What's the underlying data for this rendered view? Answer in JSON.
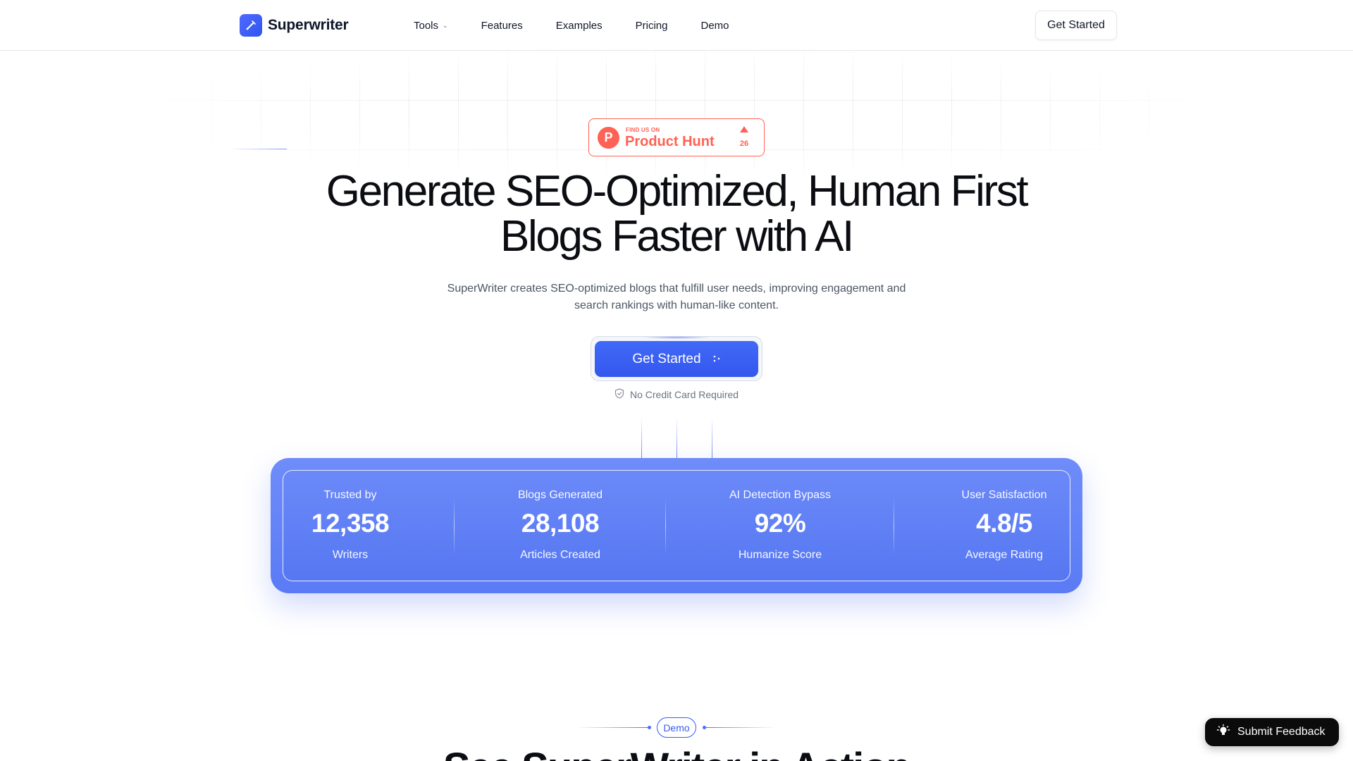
{
  "brand": {
    "name": "Superwriter",
    "logo_icon": "pen-icon",
    "accent": "#3b5bf0"
  },
  "nav": {
    "items": [
      {
        "label": "Tools",
        "has_dropdown": true
      },
      {
        "label": "Features"
      },
      {
        "label": "Examples"
      },
      {
        "label": "Pricing"
      },
      {
        "label": "Demo"
      }
    ],
    "cta_label": "Get Started"
  },
  "product_hunt": {
    "small_text": "FIND US ON",
    "big_text": "Product Hunt",
    "letter": "P",
    "upvotes": "26",
    "color": "#ff6154"
  },
  "hero": {
    "title_line1": "Generate SEO-Optimized, Human First",
    "title_line2": "Blogs Faster with AI",
    "subtitle_line1": "SuperWriter creates SEO-optimized blogs that fulfill user needs, improving engagement and",
    "subtitle_line2": "search rankings with human-like content.",
    "cta_label": "Get Started",
    "cta_icon": "sparkle-dots-icon",
    "note": "No Credit Card Required",
    "note_icon": "shield-check-icon"
  },
  "stats": [
    {
      "label": "Trusted by",
      "value": "12,358",
      "sub": "Writers"
    },
    {
      "label": "Blogs Generated",
      "value": "28,108",
      "sub": "Articles Created"
    },
    {
      "label": "AI Detection Bypass",
      "value": "92%",
      "sub": "Humanize Score"
    },
    {
      "label": "User Satisfaction",
      "value": "4.8/5",
      "sub": "Average Rating"
    }
  ],
  "demo": {
    "pill": "Demo",
    "heading": "See SuperWriter in Action"
  },
  "feedback": {
    "label": "Submit Feedback",
    "icon": "lightbulb-icon"
  }
}
